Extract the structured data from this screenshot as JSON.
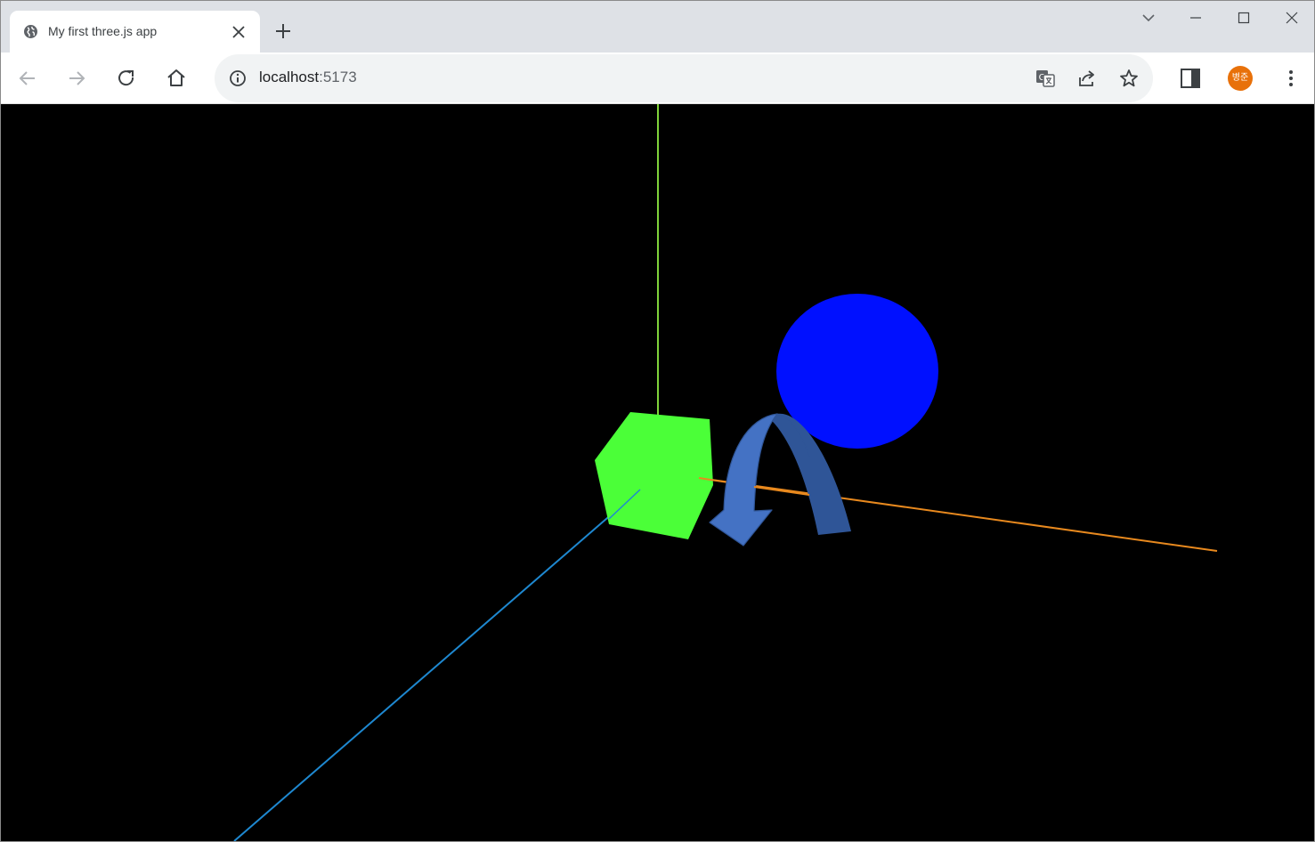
{
  "browser": {
    "tab": {
      "title": "My first three.js app",
      "favicon": "globe-icon"
    },
    "address": {
      "host": "localhost",
      "port": ":5173"
    },
    "profile": {
      "initials": "병준",
      "color": "#e8710a"
    }
  },
  "scene": {
    "background": "#000000",
    "objects": [
      {
        "name": "cube",
        "color": "#4bff38"
      },
      {
        "name": "sphere",
        "color": "#0010ff"
      },
      {
        "name": "rotation-arrow",
        "color": "#4472c4"
      }
    ],
    "axes": [
      {
        "axis": "x",
        "color": "#e8891e"
      },
      {
        "axis": "y",
        "color": "#7fd23a"
      },
      {
        "axis": "z",
        "color": "#1e88d0"
      }
    ]
  }
}
